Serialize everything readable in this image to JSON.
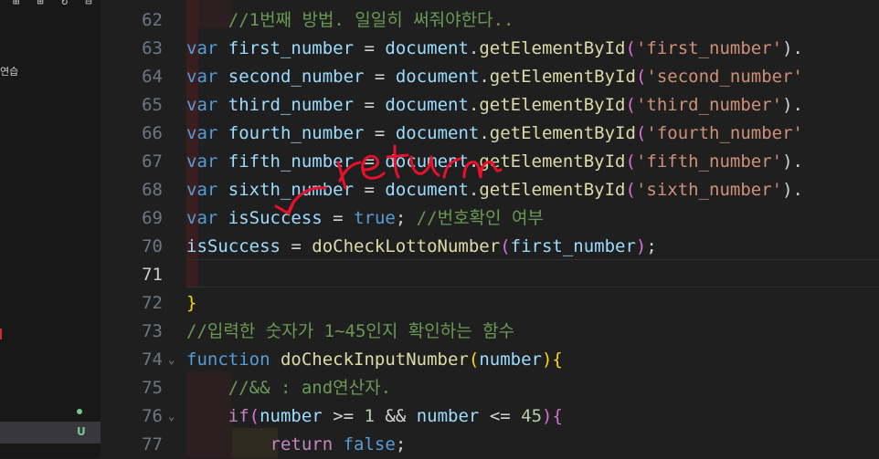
{
  "sidebar": {
    "toolbar_glyphs": "⊞ ⊞ ↻ ⊟",
    "tree_label": "연습",
    "git_status": "U"
  },
  "editor": {
    "lines": [
      {
        "number": "62",
        "tokens": [
          {
            "t": "    //1번째 방법. 일일히 써줘야한다..",
            "c": "cmt"
          }
        ]
      },
      {
        "number": "63",
        "tokens": [
          {
            "t": "var",
            "c": "kw"
          },
          {
            "t": " first_number ",
            "c": "var"
          },
          {
            "t": "= ",
            "c": "op"
          },
          {
            "t": "document",
            "c": "var"
          },
          {
            "t": ".",
            "c": "op"
          },
          {
            "t": "getElementById",
            "c": "fn"
          },
          {
            "t": "(",
            "c": "p2"
          },
          {
            "t": "'first_number'",
            "c": "str"
          },
          {
            "t": ").",
            "c": "op"
          }
        ]
      },
      {
        "number": "64",
        "tokens": [
          {
            "t": "var",
            "c": "kw"
          },
          {
            "t": " second_number ",
            "c": "var"
          },
          {
            "t": "= ",
            "c": "op"
          },
          {
            "t": "document",
            "c": "var"
          },
          {
            "t": ".",
            "c": "op"
          },
          {
            "t": "getElementById",
            "c": "fn"
          },
          {
            "t": "(",
            "c": "p2"
          },
          {
            "t": "'second_number'",
            "c": "str"
          }
        ]
      },
      {
        "number": "65",
        "tokens": [
          {
            "t": "var",
            "c": "kw"
          },
          {
            "t": " third_number ",
            "c": "var"
          },
          {
            "t": "= ",
            "c": "op"
          },
          {
            "t": "document",
            "c": "var"
          },
          {
            "t": ".",
            "c": "op"
          },
          {
            "t": "getElementById",
            "c": "fn"
          },
          {
            "t": "(",
            "c": "p2"
          },
          {
            "t": "'third_number'",
            "c": "str"
          },
          {
            "t": ").",
            "c": "op"
          }
        ]
      },
      {
        "number": "66",
        "tokens": [
          {
            "t": "var",
            "c": "kw"
          },
          {
            "t": " fourth_number ",
            "c": "var"
          },
          {
            "t": "= ",
            "c": "op"
          },
          {
            "t": "document",
            "c": "var"
          },
          {
            "t": ".",
            "c": "op"
          },
          {
            "t": "getElementById",
            "c": "fn"
          },
          {
            "t": "(",
            "c": "p2"
          },
          {
            "t": "'fourth_number'",
            "c": "str"
          }
        ]
      },
      {
        "number": "67",
        "tokens": [
          {
            "t": "var",
            "c": "kw"
          },
          {
            "t": " fifth_number ",
            "c": "var"
          },
          {
            "t": "= ",
            "c": "op"
          },
          {
            "t": "document",
            "c": "var"
          },
          {
            "t": ".",
            "c": "op"
          },
          {
            "t": "getElementById",
            "c": "fn"
          },
          {
            "t": "(",
            "c": "p2"
          },
          {
            "t": "'fifth_number'",
            "c": "str"
          },
          {
            "t": ").",
            "c": "op"
          }
        ]
      },
      {
        "number": "68",
        "tokens": [
          {
            "t": "var",
            "c": "kw"
          },
          {
            "t": " sixth_number ",
            "c": "var"
          },
          {
            "t": "= ",
            "c": "op"
          },
          {
            "t": "document",
            "c": "var"
          },
          {
            "t": ".",
            "c": "op"
          },
          {
            "t": "getElementById",
            "c": "fn"
          },
          {
            "t": "(",
            "c": "p2"
          },
          {
            "t": "'sixth_number'",
            "c": "str"
          },
          {
            "t": ").",
            "c": "op"
          }
        ]
      },
      {
        "number": "69",
        "tokens": [
          {
            "t": "var",
            "c": "kw"
          },
          {
            "t": " isSuccess ",
            "c": "var"
          },
          {
            "t": "= ",
            "c": "op"
          },
          {
            "t": "true",
            "c": "kw"
          },
          {
            "t": "; ",
            "c": "op"
          },
          {
            "t": "//번호확인 여부",
            "c": "cmt"
          }
        ]
      },
      {
        "number": "70",
        "tokens": [
          {
            "t": "isSuccess ",
            "c": "var"
          },
          {
            "t": "= ",
            "c": "op"
          },
          {
            "t": "doCheckLottoNumber",
            "c": "fn"
          },
          {
            "t": "(",
            "c": "p2"
          },
          {
            "t": "first_number",
            "c": "var"
          },
          {
            "t": ")",
            "c": "p2"
          },
          {
            "t": ";",
            "c": "op"
          }
        ]
      },
      {
        "number": "71",
        "active": true,
        "tokens": []
      },
      {
        "number": "72",
        "tokens": [
          {
            "t": "}",
            "c": "p1"
          }
        ]
      },
      {
        "number": "73",
        "tokens": [
          {
            "t": "//입력한 숫자가 1~45인지 확인하는 함수",
            "c": "cmt"
          }
        ]
      },
      {
        "number": "74",
        "fold": true,
        "tokens": [
          {
            "t": "function",
            "c": "kw"
          },
          {
            "t": " ",
            "c": "op"
          },
          {
            "t": "doCheckInputNumber",
            "c": "fn"
          },
          {
            "t": "(",
            "c": "p1"
          },
          {
            "t": "number",
            "c": "var"
          },
          {
            "t": ")",
            "c": "p1"
          },
          {
            "t": "{",
            "c": "p1"
          }
        ]
      },
      {
        "number": "75",
        "tokens": [
          {
            "t": "    //&& : and연산자.",
            "c": "cmt"
          }
        ]
      },
      {
        "number": "76",
        "fold": true,
        "tokens": [
          {
            "t": "    ",
            "c": "op"
          },
          {
            "t": "if",
            "c": "ctrl"
          },
          {
            "t": "(",
            "c": "p2"
          },
          {
            "t": "number",
            "c": "var"
          },
          {
            "t": " >= ",
            "c": "op"
          },
          {
            "t": "1",
            "c": "num"
          },
          {
            "t": " && ",
            "c": "op"
          },
          {
            "t": "number",
            "c": "var"
          },
          {
            "t": " <= ",
            "c": "op"
          },
          {
            "t": "45",
            "c": "num"
          },
          {
            "t": ")",
            "c": "p2"
          },
          {
            "t": "{",
            "c": "p2"
          }
        ]
      },
      {
        "number": "77",
        "tokens": [
          {
            "t": "        ",
            "c": "op"
          },
          {
            "t": "return",
            "c": "ctrl"
          },
          {
            "t": " ",
            "c": "op"
          },
          {
            "t": "false",
            "c": "kw"
          },
          {
            "t": ";",
            "c": "op"
          }
        ]
      }
    ]
  },
  "annotation": {
    "handwritten_text": "return",
    "color": "#e8102a"
  },
  "colors": {
    "keyword": "#569cd6",
    "string": "#ce9178",
    "function": "#dcdcaa",
    "variable": "#9cdcfe",
    "comment": "#6a9955"
  }
}
